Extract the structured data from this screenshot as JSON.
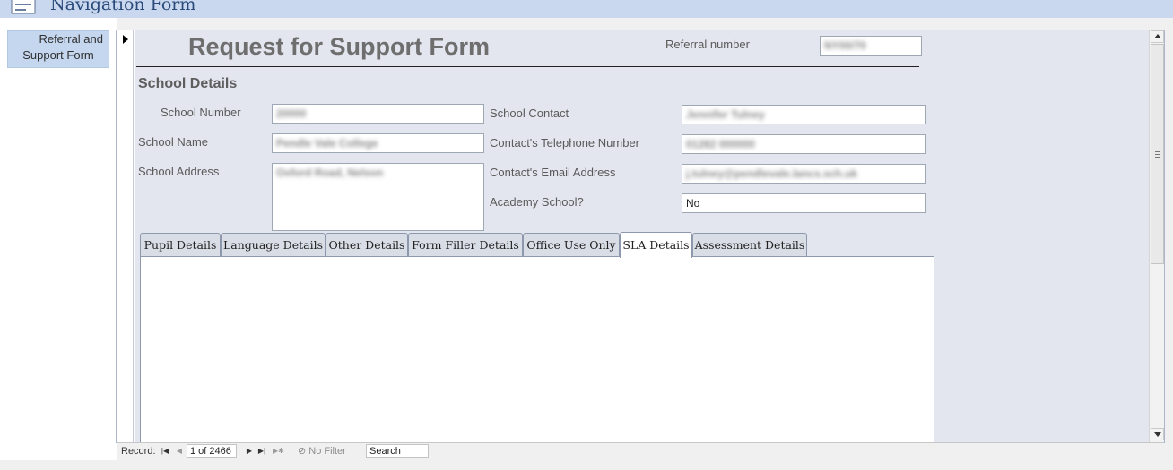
{
  "header": {
    "title": "Navigation Form",
    "icon": "form-icon"
  },
  "navigation": {
    "buttons": [
      {
        "line1": "Referral and",
        "line2": "Support Form"
      }
    ]
  },
  "form": {
    "title": "Request for Support Form",
    "referral_number": {
      "label": "Referral number",
      "value": "NY00/70"
    },
    "section_heading": "School Details",
    "left_fields": [
      {
        "label": "School Number",
        "value": "20000"
      },
      {
        "label": "School Name",
        "value": "Pendle Vale College"
      },
      {
        "label": "School Address",
        "value": "Oxford Road, Nelson"
      }
    ],
    "right_fields": [
      {
        "label": "School Contact",
        "value": "Jennifer Tulney"
      },
      {
        "label": "Contact's Telephone Number",
        "value": "01282 000000"
      },
      {
        "label": "Contact's Email Address",
        "value": "j.tulney@pendlevale.lancs.sch.uk"
      },
      {
        "label": "Academy School?",
        "value": "No"
      }
    ],
    "tabs": [
      {
        "label": "Pupil Details",
        "active": false
      },
      {
        "label": "Language Details",
        "active": false
      },
      {
        "label": "Other Details",
        "active": false
      },
      {
        "label": "Form Filler Details",
        "active": false
      },
      {
        "label": "Office Use Only",
        "active": false
      },
      {
        "label": "SLA Details",
        "active": true
      },
      {
        "label": "Assessment Details",
        "active": false
      }
    ]
  },
  "record_nav": {
    "label": "Record:",
    "position": "1 of 2466",
    "filter_label": "No Filter",
    "search_label": "Search",
    "icons": [
      "first-record-icon",
      "previous-record-icon",
      "next-record-icon",
      "last-record-icon",
      "new-record-icon",
      "filter-icon"
    ]
  }
}
